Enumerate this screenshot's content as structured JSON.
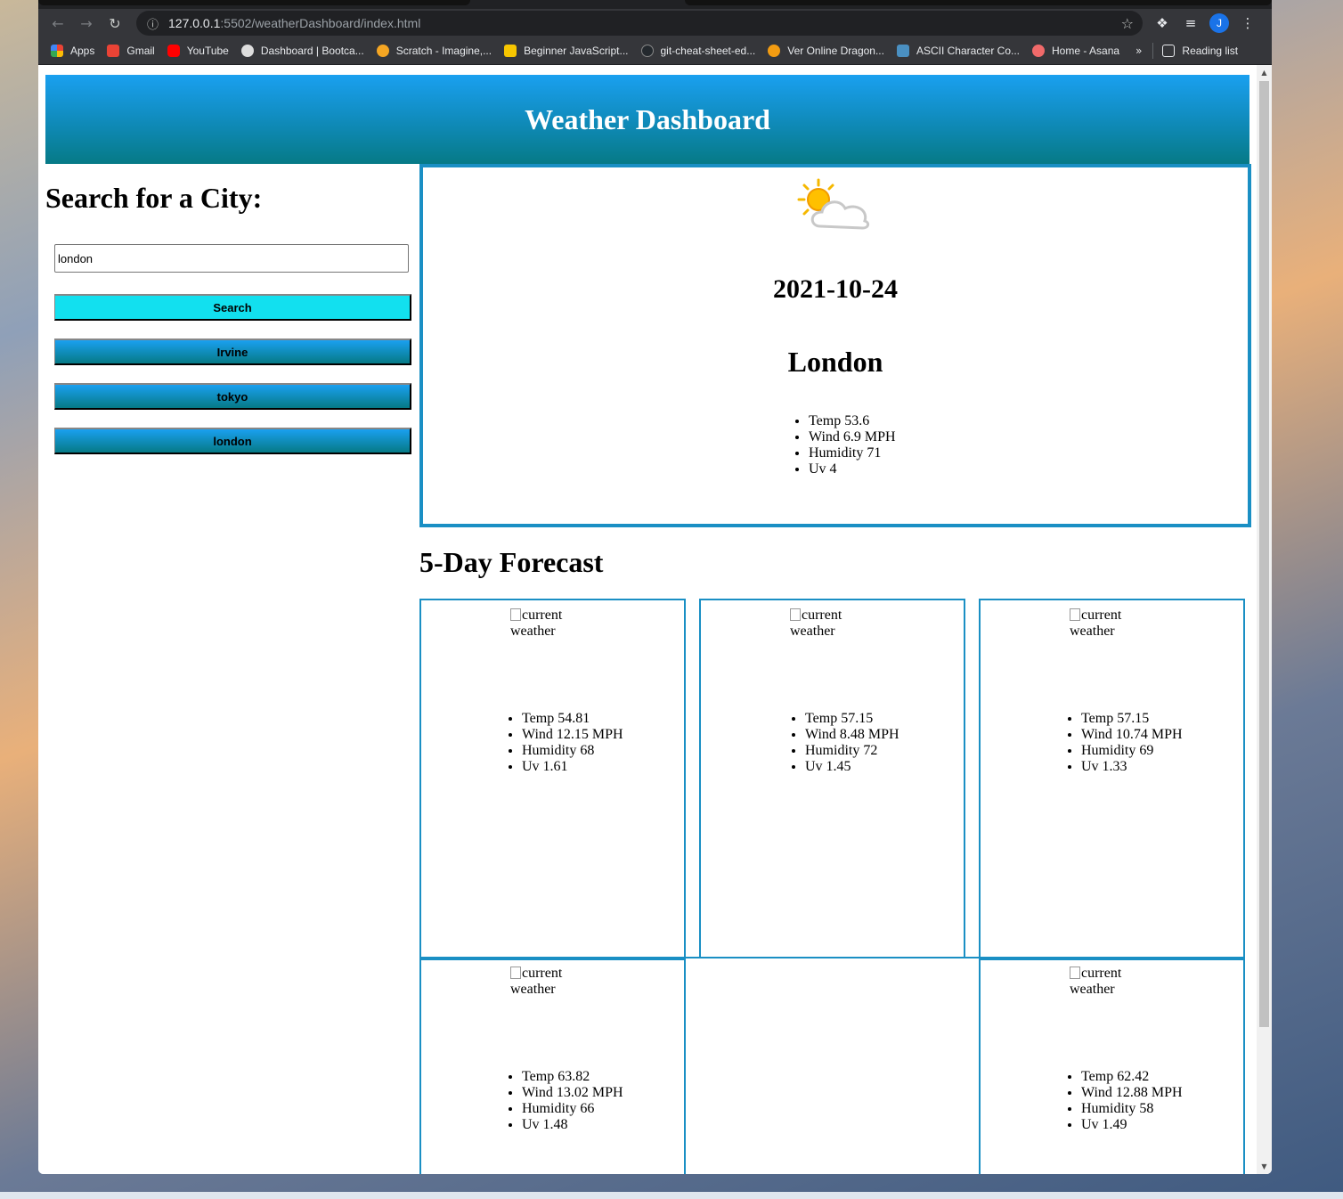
{
  "browser": {
    "url_host": "127.0.0.1",
    "url_path": ":5502/weatherDashboard/index.html",
    "avatar_letter": "J",
    "bookmarks": [
      {
        "label": "Apps",
        "color": "#e94335"
      },
      {
        "label": "Gmail",
        "color": "#ea4335"
      },
      {
        "label": "YouTube",
        "color": "#ff0000"
      },
      {
        "label": "Dashboard | Bootca...",
        "color": "#dddddd"
      },
      {
        "label": "Scratch - Imagine,...",
        "color": "#f5a623"
      },
      {
        "label": "Beginner JavaScript...",
        "color": "#f7c600"
      },
      {
        "label": "git-cheat-sheet-ed...",
        "color": "#24292e"
      },
      {
        "label": "Ver Online Dragon...",
        "color": "#f39c12"
      },
      {
        "label": "ASCII Character Co...",
        "color": "#4a90c2"
      },
      {
        "label": "Home - Asana",
        "color": "#f06a6a"
      }
    ],
    "more_label": "»",
    "reading_list": "Reading list"
  },
  "header": {
    "title": "Weather Dashboard",
    "gradient_top": "#1aa0f0",
    "gradient_bottom": "#067a86"
  },
  "sidebar": {
    "heading": "Search for a City:",
    "input_value": "london",
    "search_label": "Search",
    "history": [
      "Irvine",
      "tokyo",
      "london"
    ]
  },
  "current": {
    "icon": "partly-cloudy-icon",
    "date": "2021-10-24",
    "city": "London",
    "stats": [
      "Temp 53.6",
      "Wind 6.9 MPH",
      "Humidity 71",
      "Uv 4"
    ]
  },
  "forecast": {
    "title": "5-Day Forecast",
    "image_alt": "current weather",
    "days": [
      {
        "stats": [
          "Temp 54.81",
          "Wind 12.15 MPH",
          "Humidity 68",
          "Uv 1.61"
        ]
      },
      {
        "stats": [
          "Temp 57.15",
          "Wind 8.48 MPH",
          "Humidity 72",
          "Uv 1.45"
        ]
      },
      {
        "stats": [
          "Temp 57.15",
          "Wind 10.74 MPH",
          "Humidity 69",
          "Uv 1.33"
        ]
      },
      {
        "stats": [
          "Temp 63.82",
          "Wind 13.02 MPH",
          "Humidity 66",
          "Uv 1.48"
        ]
      },
      {
        "stats": [
          "Temp 62.42",
          "Wind 12.88 MPH",
          "Humidity 58",
          "Uv 1.49"
        ]
      }
    ]
  },
  "colors": {
    "accent_border": "#1a8fc4",
    "search_button": "#12e0ef"
  }
}
